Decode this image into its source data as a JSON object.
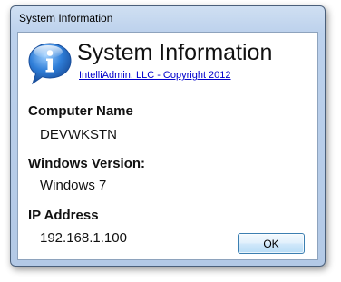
{
  "window": {
    "title": "System Information"
  },
  "header": {
    "title": "System Information",
    "copyright_link": "IntelliAdmin, LLC - Copyright 2012",
    "icon": "info-bubble-icon"
  },
  "sections": [
    {
      "label": "Computer Name",
      "value": "DEVWKSTN"
    },
    {
      "label": "Windows Version:",
      "value": "Windows 7"
    },
    {
      "label": "IP Address",
      "value": "192.168.1.100"
    }
  ],
  "buttons": {
    "ok_label": "OK"
  },
  "colors": {
    "accent": "#2f7ed8",
    "link": "#0000cc"
  }
}
